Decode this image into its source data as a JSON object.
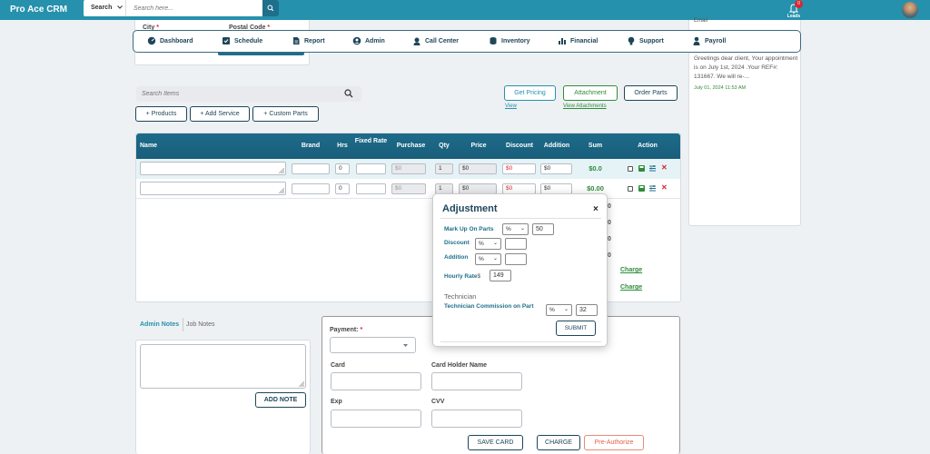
{
  "app": {
    "title": "Pro Ace CRM",
    "search_scope": "Search",
    "search_placeholder": "Search here...",
    "leads_count": "0",
    "leads_label": "Leads"
  },
  "nav": [
    "Dashboard",
    "Schedule",
    "Report",
    "Admin",
    "Call Center",
    "Inventory",
    "Financial",
    "Support",
    "Payroll"
  ],
  "address": {
    "city_label": "City",
    "postal_label": "Postal Code",
    "required_mark": "*"
  },
  "notification": {
    "header": "Email",
    "message": "Greetings dear client, Your appointment is on July 1st, 2024 .Your REF#: 131667. We will re-...",
    "time": "July 01, 2024 11:53 AM"
  },
  "items": {
    "search_placeholder": "Search Items",
    "add_buttons": [
      "+ Products",
      "+ Add Service",
      "+ Custom Parts"
    ],
    "get_pricing": "Get Pricing",
    "attachment": "Attachment",
    "order_parts": "Order Parts",
    "view_link": "View",
    "view_attachments_link": "View Attachments"
  },
  "table": {
    "headers": [
      "Name",
      "Brand",
      "Hrs",
      "Fixed Rate",
      "Purchase",
      "Qty",
      "Price",
      "Discount",
      "Addition",
      "Sum",
      "Action"
    ],
    "rows": [
      {
        "hrs": "0",
        "purchase": "$0",
        "qty": "1",
        "price": "$0",
        "discount": "$0",
        "addition": "$0",
        "sum": "$0.0"
      },
      {
        "hrs": "0",
        "purchase": "$0",
        "qty": "1",
        "price": "$0",
        "discount": "$0",
        "addition": "$0",
        "sum": "$0.00"
      }
    ],
    "side_values": [
      "0",
      "0",
      "0",
      "0"
    ],
    "charge_link": "Charge"
  },
  "notes": {
    "admin_tab": "Admin Notes",
    "job_tab": "Job Notes",
    "add_note": "ADD NOTE"
  },
  "payment": {
    "label": "Payment:",
    "required_mark": "*",
    "card": "Card",
    "holder": "Card Holder Name",
    "exp": "Exp",
    "cvv": "CVV",
    "save_card": "SAVE CARD",
    "charge": "CHARGE",
    "pre_authorize": "Pre-Authorize"
  },
  "modal": {
    "title": "Adjustment",
    "close": "×",
    "markup_label": "Mark Up On Parts",
    "markup_unit": "%",
    "markup_value": "50",
    "discount_label": "Discount",
    "discount_unit": "%",
    "addition_label": "Addition",
    "addition_unit": "%",
    "hourly_label": "Hourly Rate",
    "hourly_currency": "$",
    "hourly_value": "149",
    "technician_label": "Technician",
    "commission_label": "Technician Commission on Part",
    "commission_unit": "%",
    "commission_value": "32",
    "submit": "SUBMIT"
  },
  "colors": {
    "primary": "#2591ad",
    "header_dark": "#1d6b8a",
    "navy": "#1e4659",
    "green": "#2f8c3a",
    "red": "#d9262c"
  }
}
